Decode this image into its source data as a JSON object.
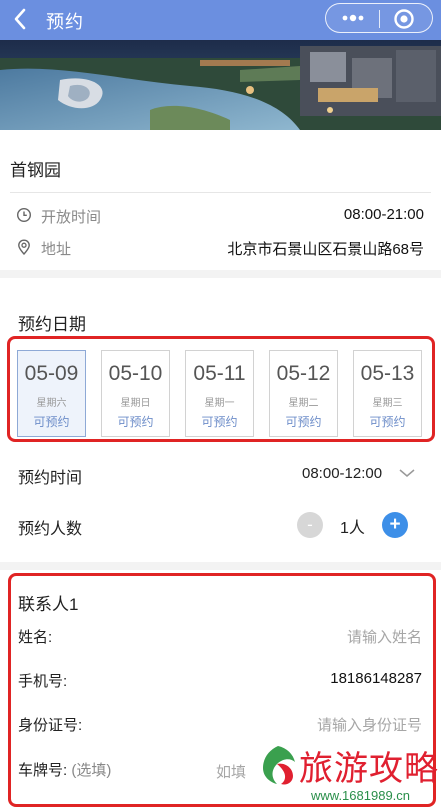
{
  "header": {
    "title": "预约",
    "back_icon": "chevron-left-icon",
    "more_icon": "more-dots-icon",
    "target_icon": "target-circle-icon",
    "background_color": "#6b8fe0"
  },
  "venue": {
    "name": "首钢园",
    "open_time_label": "开放时间",
    "open_time_value": "08:00-21:00",
    "address_label": "地址",
    "address_value": "北京市石景山区石景山路68号"
  },
  "booking_date": {
    "title": "预约日期",
    "dates": [
      {
        "date": "05-09",
        "weekday": "星期六",
        "status": "可预约",
        "selected": true
      },
      {
        "date": "05-10",
        "weekday": "星期日",
        "status": "可预约",
        "selected": false
      },
      {
        "date": "05-11",
        "weekday": "星期一",
        "status": "可预约",
        "selected": false
      },
      {
        "date": "05-12",
        "weekday": "星期二",
        "status": "可预约",
        "selected": false
      },
      {
        "date": "05-13",
        "weekday": "星期三",
        "status": "可预约",
        "selected": false
      }
    ]
  },
  "booking_time": {
    "label": "预约时间",
    "value": "08:00-12:00"
  },
  "people_count": {
    "label": "预约人数",
    "minus": "-",
    "value": "1人",
    "plus": "+"
  },
  "contact": {
    "title": "联系人1",
    "name_label": "姓名:",
    "name_placeholder": "请输入姓名",
    "phone_label": "手机号:",
    "phone_value": "18186148287",
    "id_label": "身份证号:",
    "id_placeholder": "请输入身份证号",
    "plate_label": "车牌号:",
    "plate_optional": "(选填)",
    "plate_placeholder": "如填"
  },
  "watermark": {
    "title": "旅游攻略",
    "url": "www.1681989.cn"
  },
  "colors": {
    "highlight_border": "#e02424",
    "accent_blue": "#3d8fe8",
    "available_text": "#6d8dc9"
  }
}
